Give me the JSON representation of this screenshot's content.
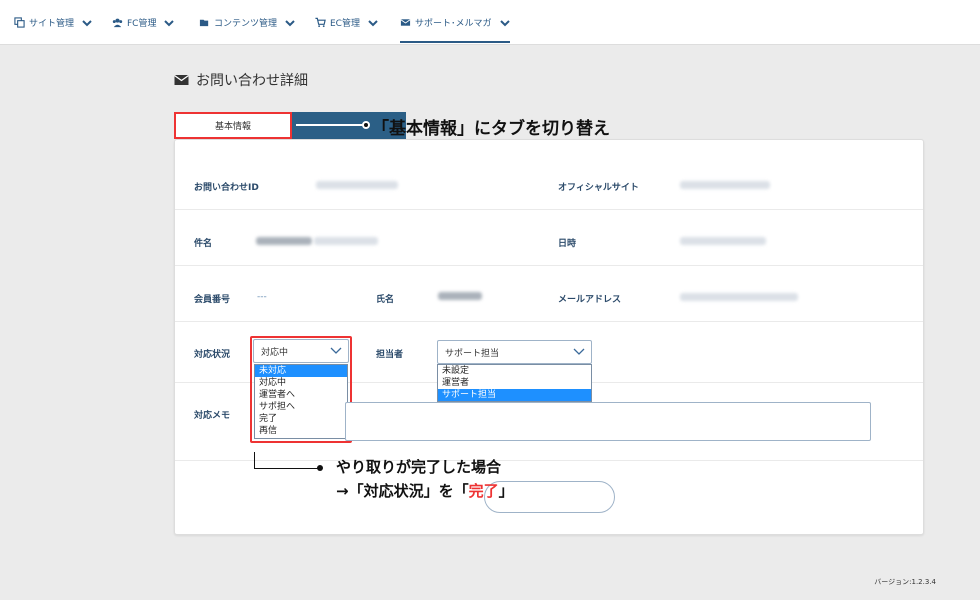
{
  "nav": [
    {
      "label": "サイト管理",
      "icon": "copy-icon"
    },
    {
      "label": "FC管理",
      "icon": "users-icon"
    },
    {
      "label": "コンテンツ管理",
      "icon": "folder-open-icon"
    },
    {
      "label": "EC管理",
      "icon": "cart-icon"
    },
    {
      "label": "サポート･メルマガ",
      "icon": "envelope-icon",
      "active": true
    }
  ],
  "page": {
    "title": "お問い合わせ詳細"
  },
  "tabs": {
    "active": "基本情報"
  },
  "callout": {
    "tab_text": "「基本情報」にタブを切り替え"
  },
  "fields": {
    "inquiry_id": "お問い合わせID",
    "official_site": "オフィシャルサイト",
    "subject": "件名",
    "datetime": "日時",
    "member_no": "会員番号",
    "name": "氏名",
    "email": "メールアドレス",
    "status": "対応状況",
    "assignee": "担当者",
    "memo": "対応メモ"
  },
  "status_select": {
    "value": "対応中",
    "options": [
      "未対応",
      "対応中",
      "運営者へ",
      "サポ担へ",
      "完了",
      "再信"
    ],
    "highlighted": 0
  },
  "assignee_select": {
    "value": "サポート担当",
    "options": [
      "未設定",
      "運営者",
      "サポート担当"
    ],
    "highlighted": 2
  },
  "member_no_value": "---",
  "note": {
    "line1": "やり取りが完了した場合",
    "line2_prefix": "→「対応状況」を「",
    "line2_highlight": "完了",
    "line2_suffix": "」"
  },
  "version": "バージョン:1.2.3.4",
  "colors": {
    "accent": "#2b5f86",
    "highlight_red": "#ee3333",
    "select_blue": "#1e90ff"
  }
}
